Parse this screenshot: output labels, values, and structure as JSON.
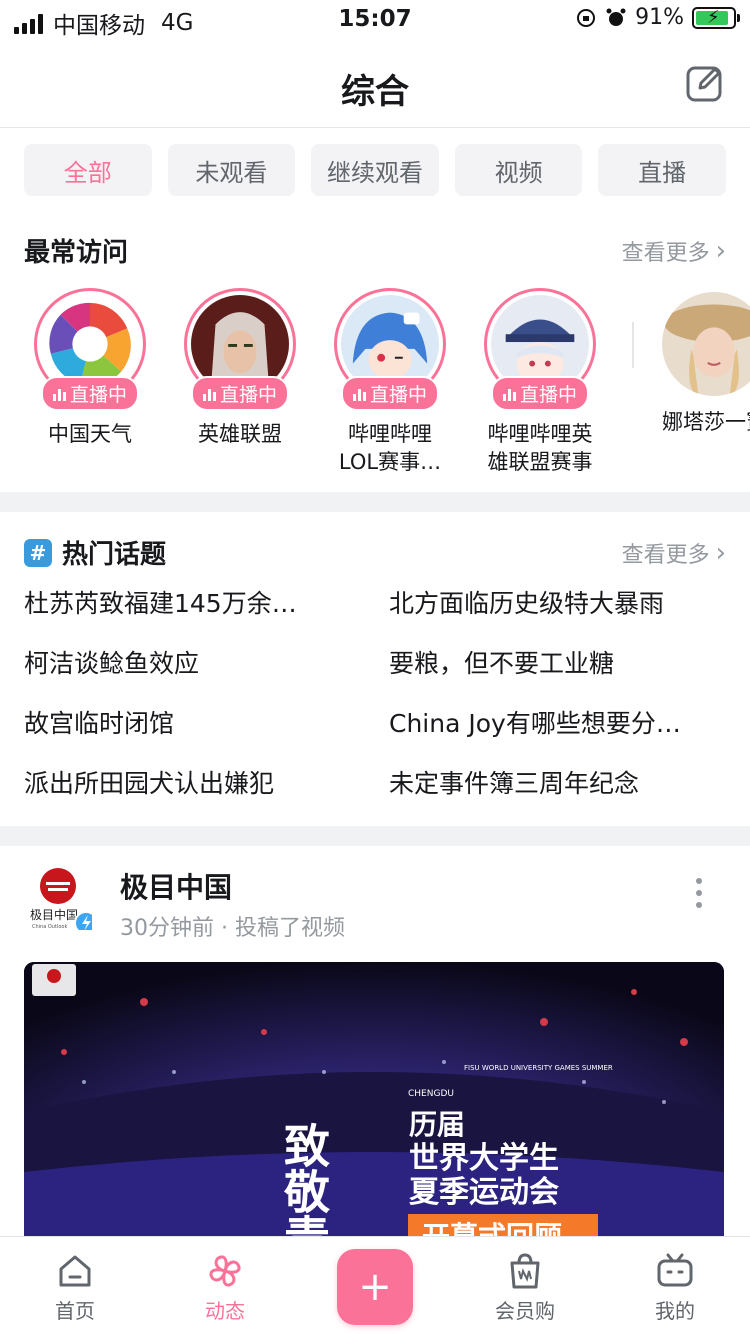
{
  "status_bar": {
    "carrier": "中国移动",
    "network": "4G",
    "time": "15:07",
    "battery": "91%"
  },
  "header": {
    "title": "综合"
  },
  "tabs": [
    {
      "label": "全部",
      "active": true
    },
    {
      "label": "未观看",
      "active": false
    },
    {
      "label": "继续观看",
      "active": false
    },
    {
      "label": "视频",
      "active": false
    },
    {
      "label": "直播",
      "active": false
    }
  ],
  "frequent": {
    "title": "最常访问",
    "more_label": "查看更多",
    "items": [
      {
        "name": "中国天气",
        "badge": "直播中"
      },
      {
        "name": "英雄联盟",
        "badge": "直播中"
      },
      {
        "name": "哔哩哔哩LOL赛事…",
        "badge": "直播中"
      },
      {
        "name": "哔哩哔哩英雄联盟赛事",
        "badge": "直播中"
      },
      {
        "name": "娜塔莎一寶"
      }
    ]
  },
  "hot_topics": {
    "title": "热门话题",
    "more_label": "查看更多",
    "items": [
      "杜苏芮致福建145万余…",
      "北方面临历史级特大暴雨",
      "柯洁谈鲶鱼效应",
      "要粮，但不要工业糖",
      "故宫临时闭馆",
      "China Joy有哪些想要分…",
      "派出所田园犬认出嫌犯",
      "未定事件簿三周年纪念"
    ]
  },
  "post": {
    "author": "极目中国",
    "logo_text": "极目中国",
    "logo_sub": "China Outlook",
    "time": "30分钟前",
    "action": "投稿了视频",
    "video": {
      "vertical_text": "致敬青春",
      "brand": "CHENGDU",
      "fisu": "FISU WORLD UNIVERSITY GAMES SUMMER",
      "line1": "历届",
      "line2": "世界大学生",
      "line3": "夏季运动会",
      "line4": "开幕式回顾"
    }
  },
  "bottom_nav": [
    {
      "label": "首页",
      "icon": "home-icon",
      "active": false
    },
    {
      "label": "动态",
      "icon": "pinwheel-icon",
      "active": true
    },
    {
      "label": "",
      "icon": "plus-icon",
      "active": false
    },
    {
      "label": "会员购",
      "icon": "shopping-bag-icon",
      "active": false
    },
    {
      "label": "我的",
      "icon": "tv-icon",
      "active": false
    }
  ],
  "colors": {
    "accent": "#fb7299",
    "muted": "#9499a0",
    "text": "#18191c"
  }
}
